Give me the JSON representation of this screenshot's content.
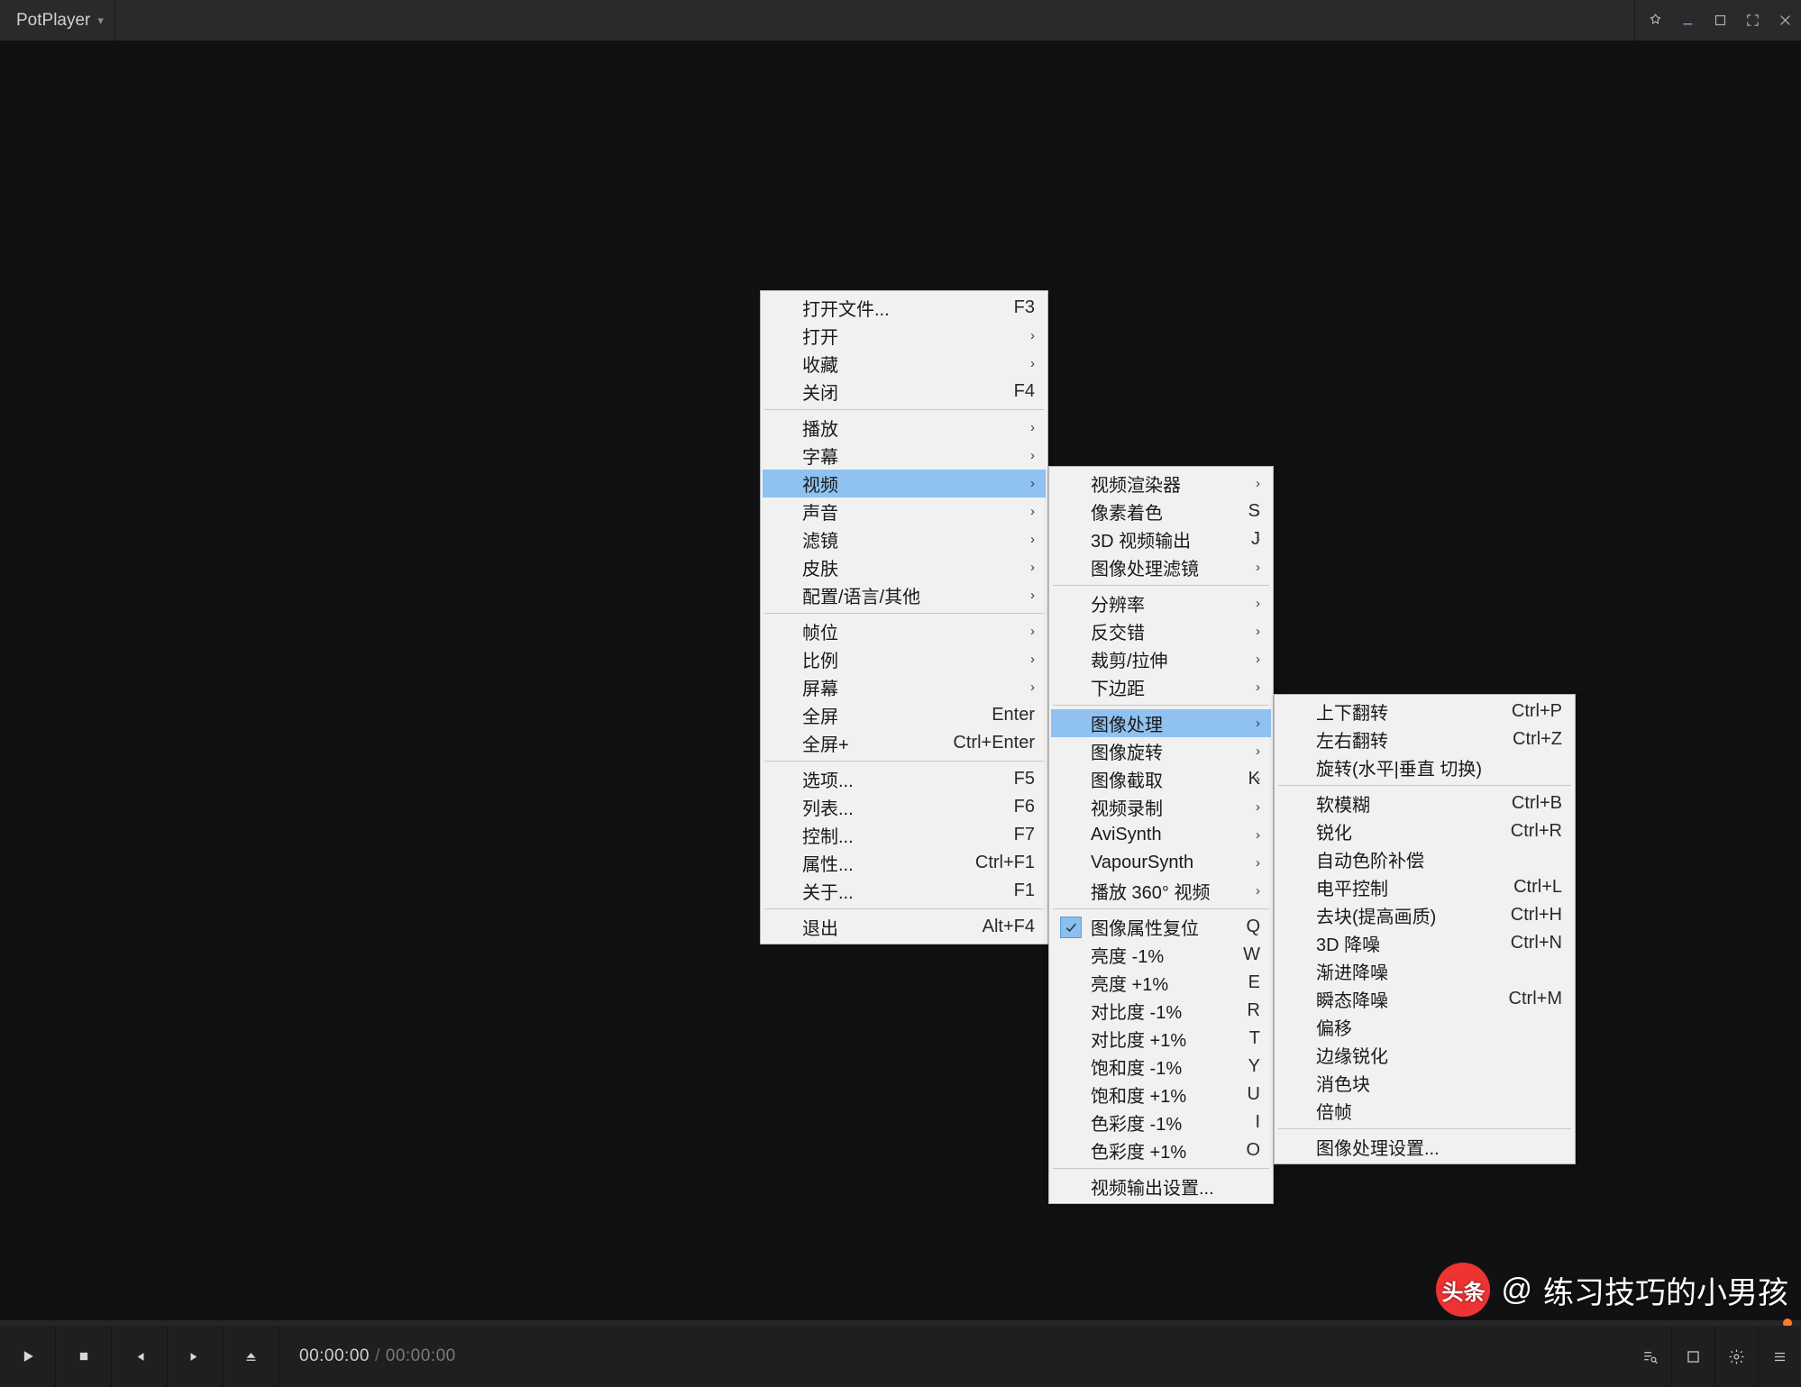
{
  "title": "PotPlayer",
  "time": {
    "current": "00:00:00",
    "duration": "00:00:00"
  },
  "watermark": {
    "logo_text": "头条",
    "prefix": "@",
    "name": "练习技巧的小男孩"
  },
  "menu1": [
    {
      "label": "打开文件...",
      "accel": "F3"
    },
    {
      "label": "打开",
      "sub": true
    },
    {
      "label": "收藏",
      "sub": true
    },
    {
      "label": "关闭",
      "accel": "F4"
    },
    {
      "divider": true
    },
    {
      "label": "播放",
      "sub": true
    },
    {
      "label": "字幕",
      "sub": true
    },
    {
      "label": "视频",
      "sub": true,
      "hl": true
    },
    {
      "label": "声音",
      "sub": true
    },
    {
      "label": "滤镜",
      "sub": true
    },
    {
      "label": "皮肤",
      "sub": true
    },
    {
      "label": "配置/语言/其他",
      "sub": true
    },
    {
      "divider": true
    },
    {
      "label": "帧位",
      "sub": true
    },
    {
      "label": "比例",
      "sub": true
    },
    {
      "label": "屏幕",
      "sub": true
    },
    {
      "label": "全屏",
      "accel": "Enter"
    },
    {
      "label": "全屏+",
      "accel": "Ctrl+Enter"
    },
    {
      "divider": true
    },
    {
      "label": "选项...",
      "accel": "F5"
    },
    {
      "label": "列表...",
      "accel": "F6"
    },
    {
      "label": "控制...",
      "accel": "F7"
    },
    {
      "label": "属性...",
      "accel": "Ctrl+F1"
    },
    {
      "label": "关于...",
      "accel": "F1"
    },
    {
      "divider": true
    },
    {
      "label": "退出",
      "accel": "Alt+F4"
    }
  ],
  "menu2": [
    {
      "label": "视频渲染器",
      "sub": true
    },
    {
      "label": "像素着色",
      "accel": "S",
      "sub": true
    },
    {
      "label": "3D 视频输出",
      "accel": "J",
      "sub": true
    },
    {
      "label": "图像处理滤镜",
      "sub": true
    },
    {
      "divider": true
    },
    {
      "label": "分辨率",
      "sub": true
    },
    {
      "label": "反交错",
      "sub": true
    },
    {
      "label": "裁剪/拉伸",
      "sub": true
    },
    {
      "label": "下边距",
      "sub": true
    },
    {
      "divider": true
    },
    {
      "label": "图像处理",
      "sub": true,
      "hl": true
    },
    {
      "label": "图像旋转",
      "sub": true
    },
    {
      "label": "图像截取",
      "accel": "K",
      "sub": true
    },
    {
      "label": "视频录制",
      "sub": true
    },
    {
      "label": "AviSynth",
      "sub": true
    },
    {
      "label": "VapourSynth",
      "sub": true
    },
    {
      "label": "播放 360° 视频",
      "sub": true
    },
    {
      "divider": true
    },
    {
      "label": "图像属性复位",
      "accel": "Q",
      "check": true
    },
    {
      "label": "亮度 -1%",
      "accel": "W"
    },
    {
      "label": "亮度 +1%",
      "accel": "E"
    },
    {
      "label": "对比度 -1%",
      "accel": "R"
    },
    {
      "label": "对比度 +1%",
      "accel": "T"
    },
    {
      "label": "饱和度 -1%",
      "accel": "Y"
    },
    {
      "label": "饱和度 +1%",
      "accel": "U"
    },
    {
      "label": "色彩度 -1%",
      "accel": "I"
    },
    {
      "label": "色彩度 +1%",
      "accel": "O"
    },
    {
      "divider": true
    },
    {
      "label": "视频输出设置..."
    }
  ],
  "menu3": [
    {
      "label": "上下翻转",
      "accel": "Ctrl+P"
    },
    {
      "label": "左右翻转",
      "accel": "Ctrl+Z"
    },
    {
      "label": "旋转(水平|垂直 切换)"
    },
    {
      "divider": true
    },
    {
      "label": "软模糊",
      "accel": "Ctrl+B"
    },
    {
      "label": "锐化",
      "accel": "Ctrl+R"
    },
    {
      "label": "自动色阶补偿"
    },
    {
      "label": "电平控制",
      "accel": "Ctrl+L"
    },
    {
      "label": "去块(提高画质)",
      "accel": "Ctrl+H"
    },
    {
      "label": "3D 降噪",
      "accel": "Ctrl+N"
    },
    {
      "label": "渐进降噪"
    },
    {
      "label": "瞬态降噪",
      "accel": "Ctrl+M"
    },
    {
      "label": "偏移"
    },
    {
      "label": "边缘锐化"
    },
    {
      "label": "消色块"
    },
    {
      "label": "倍帧"
    },
    {
      "divider": true
    },
    {
      "label": "图像处理设置..."
    }
  ]
}
